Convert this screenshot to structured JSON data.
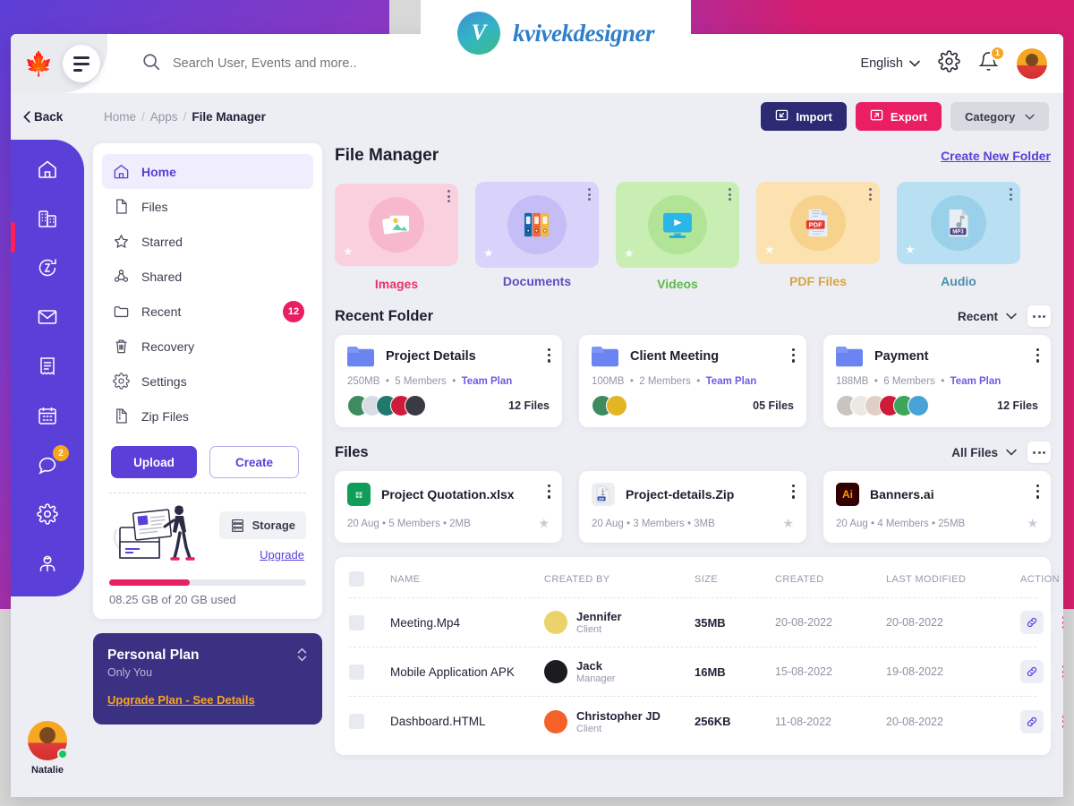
{
  "watermark": {
    "brand": "kvivekdesigner",
    "mark": "V"
  },
  "topbar": {
    "logo_icon": "leaf-logo",
    "search_placeholder": "Search User, Events and more..",
    "search_value": "",
    "language": "English",
    "notification_count": "1"
  },
  "breadcrumb": {
    "back": "Back",
    "items": [
      "Home",
      "Apps",
      "File Manager"
    ],
    "import": "Import",
    "export": "Export",
    "category": "Category"
  },
  "rail": {
    "icons": [
      "home-icon",
      "building-icon",
      "crypto-icon",
      "mail-icon",
      "invoice-icon",
      "calendar-icon",
      "chat-icon",
      "gear-icon",
      "user-support-icon"
    ],
    "chat_badge": "2",
    "user_name": "Natalie"
  },
  "sidebar": {
    "items": [
      {
        "label": "Home",
        "icon": "home-icon",
        "active": true
      },
      {
        "label": "Files",
        "icon": "file-icon",
        "active": false
      },
      {
        "label": "Starred",
        "icon": "star-icon",
        "active": false
      },
      {
        "label": "Shared",
        "icon": "share-icon",
        "active": false
      },
      {
        "label": "Recent",
        "icon": "folder-icon",
        "active": false,
        "badge": "12"
      },
      {
        "label": "Recovery",
        "icon": "trash-icon",
        "active": false
      },
      {
        "label": "Settings",
        "icon": "gear-icon",
        "active": false
      },
      {
        "label": "Zip Files",
        "icon": "zip-icon",
        "active": false
      }
    ],
    "upload_label": "Upload",
    "create_label": "Create",
    "storage_chip": "Storage",
    "upgrade_link": "Upgrade",
    "storage_used_text": "08.25 GB of 20 GB used",
    "storage_percent": 41
  },
  "plan": {
    "title": "Personal Plan",
    "subtitle": "Only You",
    "link": "Upgrade Plan - See Details"
  },
  "main": {
    "title": "File Manager",
    "create_folder": "Create New Folder",
    "categories": [
      {
        "label": "Images",
        "icon": "image-icon",
        "card_bg": "#fbd0de",
        "bubble_bg": "#f7b8ce",
        "label_color": "#e8336e",
        "offset": 0
      },
      {
        "label": "Documents",
        "icon": "binders-icon",
        "card_bg": "#d9d3fb",
        "bubble_bg": "#c5bdf5",
        "label_color": "#5a4fc4",
        "offset": 8
      },
      {
        "label": "Videos",
        "icon": "video-icon",
        "card_bg": "#c9eeb4",
        "bubble_bg": "#b2e497",
        "label_color": "#5eb947",
        "offset": 4
      },
      {
        "label": "PDF Files",
        "icon": "pdf-icon",
        "card_bg": "#fbe2b0",
        "bubble_bg": "#f7d28c",
        "label_color": "#d6a63c",
        "offset": 1
      },
      {
        "label": "Audio",
        "icon": "mp3-icon",
        "card_bg": "#b8dff2",
        "bubble_bg": "#9ad0ea",
        "label_color": "#4c8fad",
        "offset": 1
      }
    ],
    "recent_folder": {
      "title": "Recent Folder",
      "filter": "Recent",
      "cards": [
        {
          "name": "Project Details",
          "size": "250MB",
          "members": "5 Members",
          "plan": "Team Plan",
          "files": "12 Files",
          "avatars": [
            "#3d8b5f",
            "#d8dce5",
            "#1f7a6d",
            "#cf1b3a",
            "#3a3a44"
          ]
        },
        {
          "name": "Client Meeting",
          "size": "100MB",
          "members": "2 Members",
          "plan": "Team Plan",
          "files": "05 Files",
          "avatars": [
            "#3d8b5f",
            "#e3b423"
          ]
        },
        {
          "name": "Payment",
          "size": "188MB",
          "members": "6 Members",
          "plan": "Team Plan",
          "files": "12 Files",
          "avatars": [
            "#c9c4c0",
            "#ece9e4",
            "#e0cfc4",
            "#cf1b3a",
            "#3da55a",
            "#4aa3d8"
          ]
        }
      ]
    },
    "files": {
      "title": "Files",
      "filter": "All Files",
      "cards": [
        {
          "name": "Project Quotation.xlsx",
          "meta": "20 Aug  •  5 Members  •  2MB",
          "badge": "X",
          "badge_bg": "#0f9d58"
        },
        {
          "name": "Project-details.Zip",
          "meta": "20 Aug  •  3 Members  •  3MB",
          "badge": "ZIP",
          "badge_bg": "#3f51b5"
        },
        {
          "name": "Banners.ai",
          "meta": "20 Aug  •  4 Members  •  25MB",
          "badge": "Ai",
          "badge_bg": "#330000"
        }
      ]
    },
    "table": {
      "columns": [
        "NAME",
        "CREATED BY",
        "SIZE",
        "CREATED",
        "LAST MODIFIED",
        "ACTION"
      ],
      "rows": [
        {
          "name": "Meeting.Mp4",
          "by_name": "Jennifer",
          "by_role": "Client",
          "by_color": "#ead36a",
          "size": "35MB",
          "created": "20-08-2022",
          "modified": "20-08-2022"
        },
        {
          "name": "Mobile Application APK",
          "by_name": "Jack",
          "by_role": "Manager",
          "by_color": "#1c1c20",
          "size": "16MB",
          "created": "15-08-2022",
          "modified": "19-08-2022"
        },
        {
          "name": "Dashboard.HTML",
          "by_name": "Christopher JD",
          "by_role": "Client",
          "by_color": "#f4622a",
          "size": "256KB",
          "created": "11-08-2022",
          "modified": "20-08-2022"
        }
      ]
    }
  },
  "colors": {
    "primary": "#5a3fd8",
    "accent_pink": "#e91e63",
    "navy": "#2b2a72",
    "plan_card": "#3b3183",
    "orange": "#f5a623"
  }
}
